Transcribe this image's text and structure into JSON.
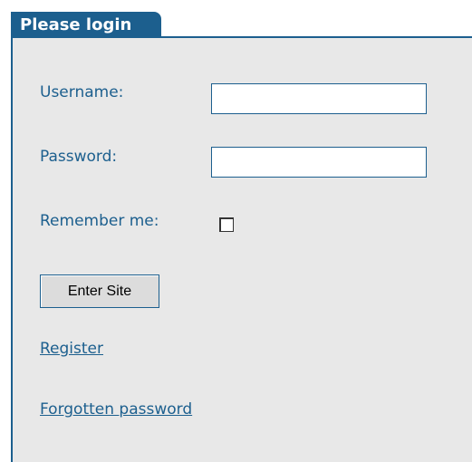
{
  "login": {
    "tab_title": "Please login",
    "username_label": "Username:",
    "username_value": "",
    "password_label": "Password:",
    "password_value": "",
    "remember_label": "Remember me:",
    "remember_checked": false,
    "submit_label": "Enter Site",
    "register_link": "Register",
    "forgot_link": "Forgotten password"
  },
  "colors": {
    "accent": "#1c5f8e",
    "panel_bg": "#e8e8e8"
  }
}
